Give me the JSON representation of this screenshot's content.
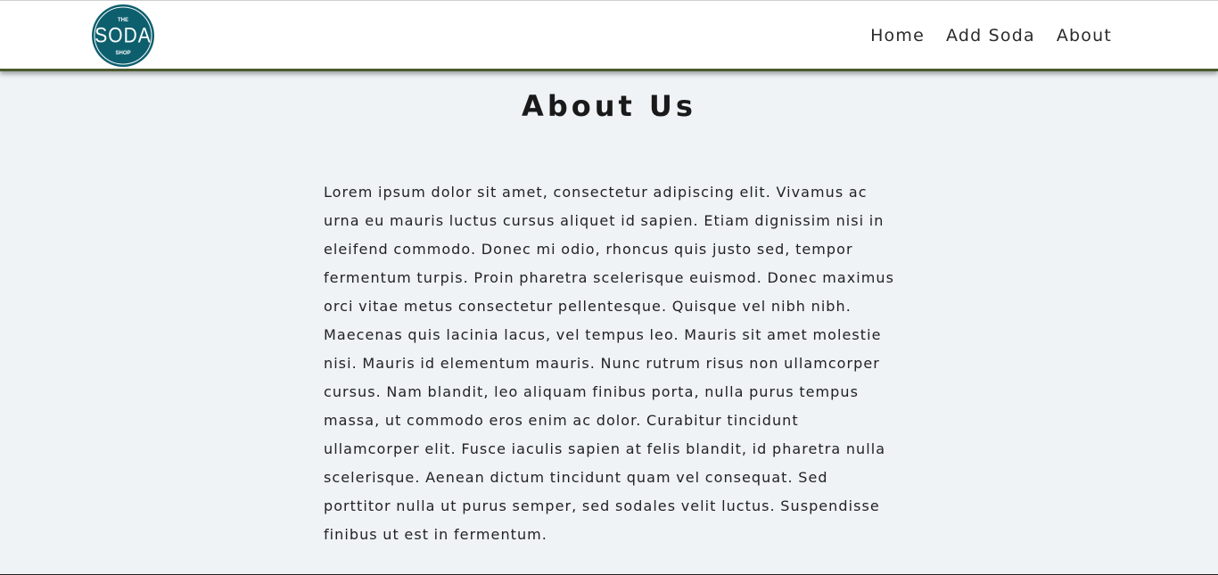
{
  "header": {
    "logo": {
      "line1": "THE",
      "line2": "SODA",
      "line3": "SHOP",
      "color": "#0d5f6e"
    },
    "nav": [
      {
        "label": "Home"
      },
      {
        "label": "Add Soda"
      },
      {
        "label": "About"
      }
    ]
  },
  "main": {
    "title": "About Us",
    "body": "Lorem ipsum dolor sit amet, consectetur adipiscing elit. Vivamus ac urna eu mauris luctus cursus aliquet id sapien. Etiam dignissim nisi in eleifend commodo. Donec mi odio, rhoncus quis justo sed, tempor fermentum turpis. Proin pharetra scelerisque euismod. Donec maximus orci vitae metus consectetur pellentesque. Quisque vel nibh nibh. Maecenas quis lacinia lacus, vel tempus leo. Mauris sit amet molestie nisi. Mauris id elementum mauris. Nunc rutrum risus non ullamcorper cursus. Nam blandit, leo aliquam finibus porta, nulla purus tempus massa, ut commodo eros enim ac dolor. Curabitur tincidunt ullamcorper elit. Fusce iaculis sapien at felis blandit, id pharetra nulla scelerisque. Aenean dictum tincidunt quam vel consequat. Sed porttitor nulla ut purus semper, sed sodales velit luctus. Suspendisse finibus ut est in fermentum."
  }
}
